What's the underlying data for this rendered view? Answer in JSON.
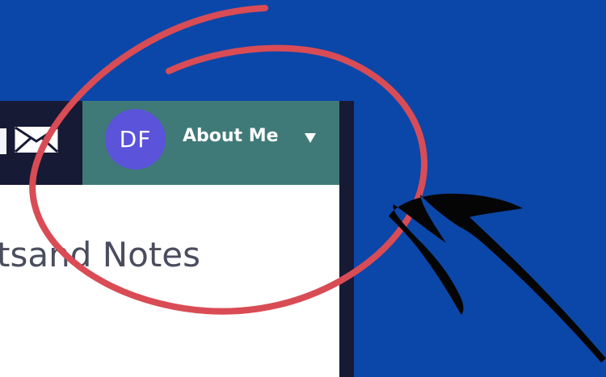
{
  "header": {
    "avatar_initials": "DF",
    "menu_label": "About Me",
    "mail_icon": "mail-icon",
    "dropdown_icon": "caret-down-icon"
  },
  "content": {
    "heading_fragment": "ts",
    "heading_rest": "and Notes"
  },
  "annotations": {
    "circle_color": "#d94c55",
    "arrow_color": "#050505"
  },
  "colors": {
    "background": "#0b47a8",
    "topbar": "#171a35",
    "profile_panel": "#3f7a78",
    "avatar": "#5b53d9",
    "content_background": "#ffffff",
    "heading_text": "#4a4d5d"
  }
}
